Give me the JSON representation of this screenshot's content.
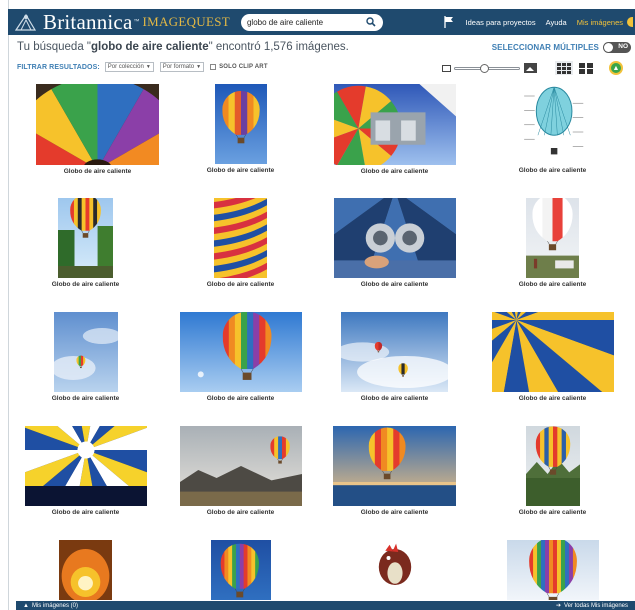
{
  "header": {
    "brand": "Britannica",
    "brand_product": "IMAGEQUEST",
    "brand_tm": "™",
    "search_value": "globo de aire caliente",
    "nav": {
      "ideas": "Ideas para proyectos",
      "help": "Ayuda",
      "my_images": "Mis imágenes"
    },
    "icons": {
      "logo": "thistle-logo-icon",
      "search": "search-icon",
      "flag": "flag-icon"
    }
  },
  "results": {
    "prefix": "Tu búsqueda \"",
    "query": "globo de aire caliente",
    "suffix": "\" encontró 1,576 imágenes.",
    "multi_select_label": "SELECCIONAR MÚLTIPLES",
    "multi_select_state": "NO"
  },
  "filters": {
    "label": "FILTRAR RESULTADOS:",
    "collection": "Por colección",
    "format": "Por formato",
    "clip_art": "SOLO CLIP ART"
  },
  "view": {
    "thumbnail_size_level": 0.45,
    "grid_modes": [
      "large-grid",
      "small-grid"
    ],
    "active_grid": "large-grid"
  },
  "gallery": {
    "items": [
      {
        "caption": "Globo de aire caliente",
        "art": "rainbow-envelope"
      },
      {
        "caption": "Globo de aire caliente",
        "art": "orange-balloon-blue-sky"
      },
      {
        "caption": "Globo de aire caliente",
        "art": "burner-blue"
      },
      {
        "caption": "Globo de aire caliente",
        "art": "balloon-diagram"
      },
      {
        "caption": "Globo de aire caliente",
        "art": "striped-balloon-trees"
      },
      {
        "caption": "Globo de aire caliente",
        "art": "stripes-red-yellow"
      },
      {
        "caption": "Globo de aire caliente",
        "art": "burner-hand"
      },
      {
        "caption": "Globo de aire caliente",
        "art": "white-red-balloon-field"
      },
      {
        "caption": "Globo de aire caliente",
        "art": "small-balloon-clouds"
      },
      {
        "caption": "Globo de aire caliente",
        "art": "rainbow-balloon-sky"
      },
      {
        "caption": "Globo de aire caliente",
        "art": "two-balloons-clouds"
      },
      {
        "caption": "Globo de aire caliente",
        "art": "blue-yellow-envelope"
      },
      {
        "caption": "Globo de aire caliente",
        "art": "yellow-blue-inside"
      },
      {
        "caption": "Globo de aire caliente",
        "art": "balloon-mountain-landscape"
      },
      {
        "caption": "Globo de aire caliente",
        "art": "balloon-over-sea"
      },
      {
        "caption": "Globo de aire caliente",
        "art": "red-yellow-balloon-forest"
      },
      {
        "caption": "",
        "art": "flame-glow"
      },
      {
        "caption": "",
        "art": "rainbow-balloon-blue"
      },
      {
        "caption": "",
        "art": "rooster-balloon"
      },
      {
        "caption": "",
        "art": "colorful-balloon-clouds"
      }
    ]
  },
  "footer": {
    "my_images": "Mis imágenes (0)",
    "see_all": "Ver todas Mis imágenes"
  },
  "colors": {
    "header_bg": "#1f4a6e",
    "accent_yellow": "#f2c23a",
    "link_blue": "#3f7fb4"
  }
}
